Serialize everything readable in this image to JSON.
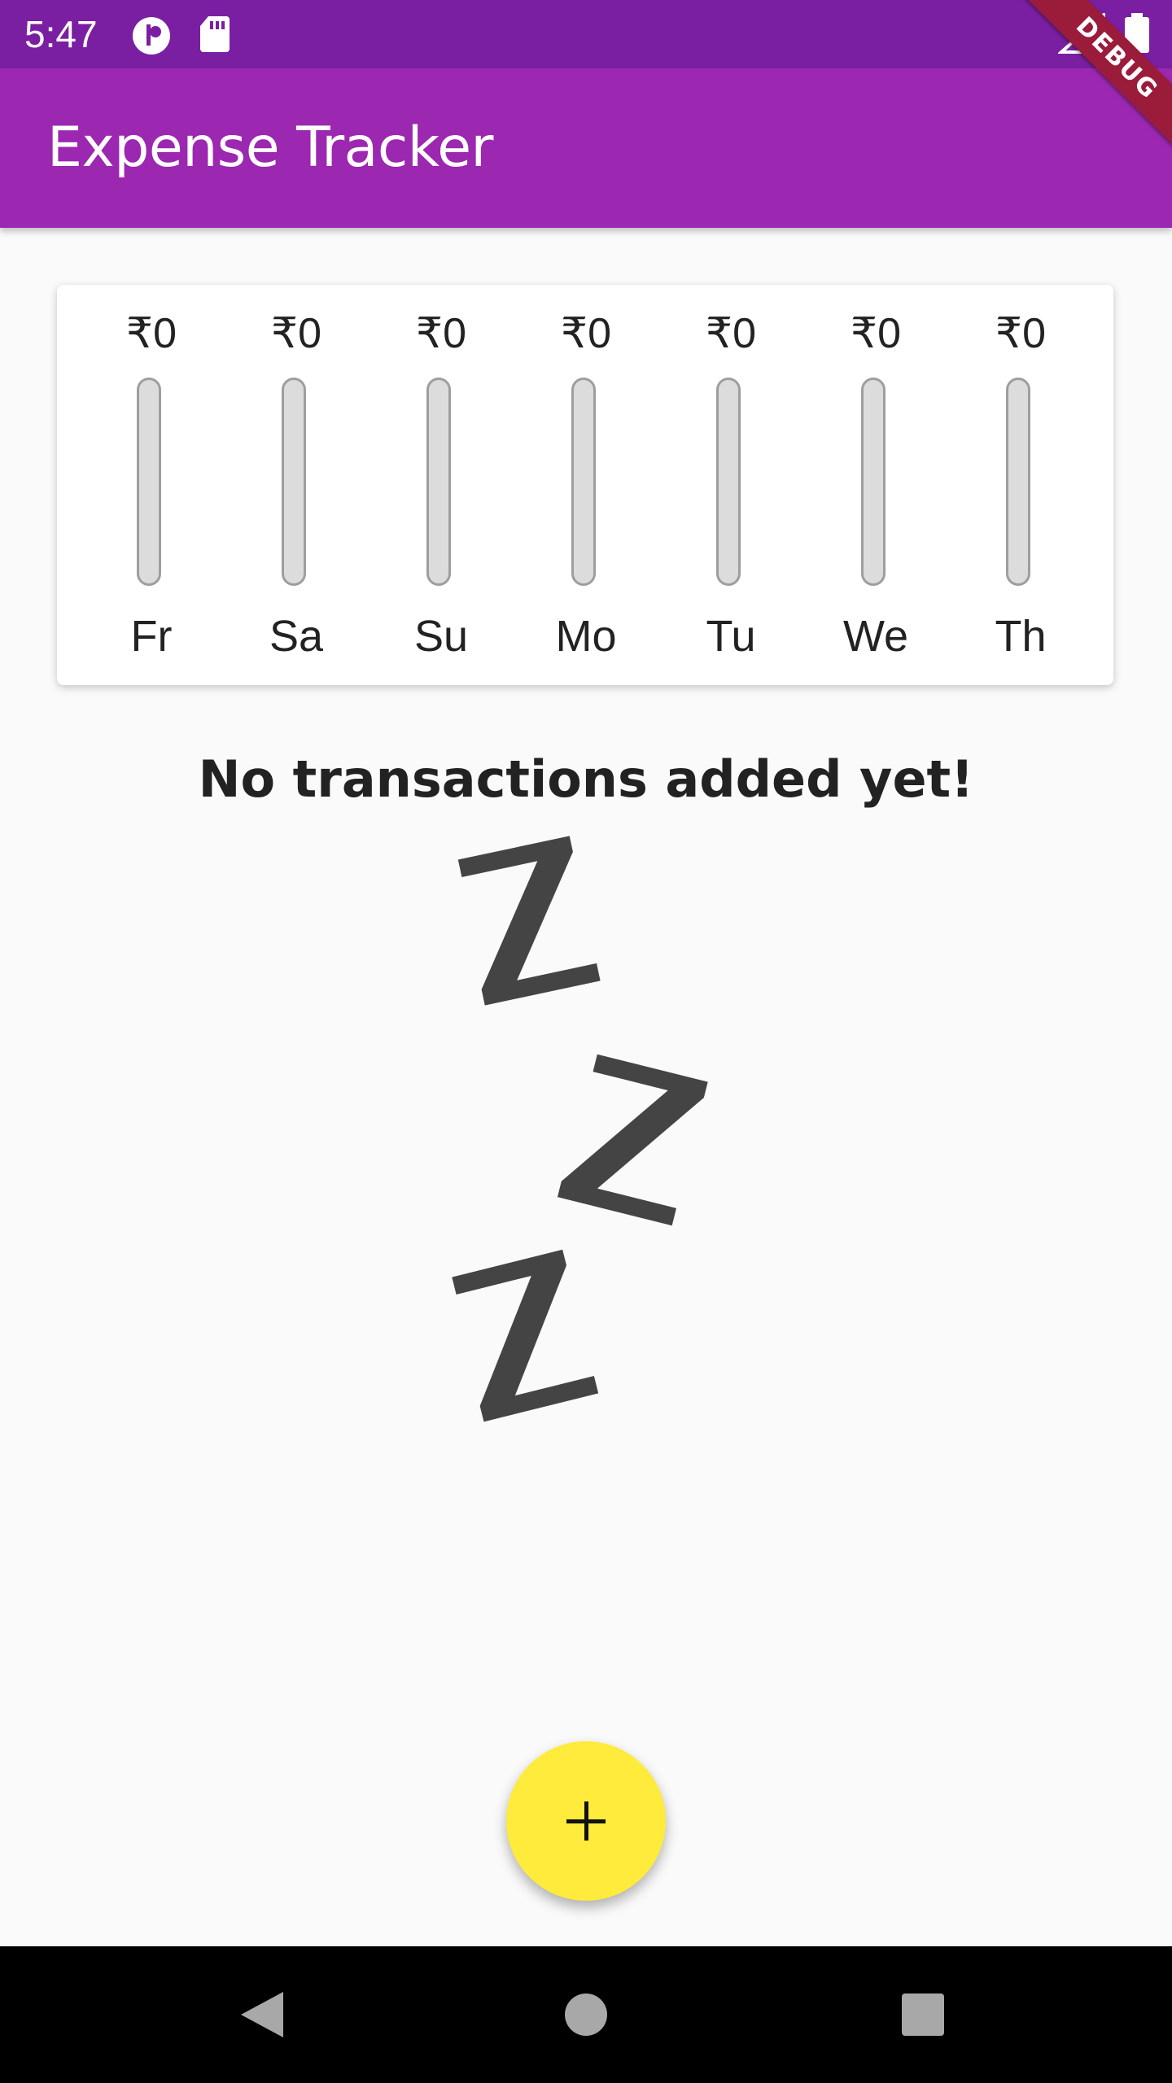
{
  "status_bar": {
    "time": "5:47",
    "left_icons": [
      "circle-badge-icon",
      "sd-card-icon"
    ],
    "right_icons": [
      "cell-signal-icon",
      "battery-icon"
    ]
  },
  "app_bar": {
    "title": "Expense Tracker"
  },
  "debug_banner": {
    "label": "DEBUG"
  },
  "chart": {
    "days": [
      {
        "label": "Fr",
        "amount": "₹0",
        "fill_pct": 0
      },
      {
        "label": "Sa",
        "amount": "₹0",
        "fill_pct": 0
      },
      {
        "label": "Su",
        "amount": "₹0",
        "fill_pct": 0
      },
      {
        "label": "Mo",
        "amount": "₹0",
        "fill_pct": 0
      },
      {
        "label": "Tu",
        "amount": "₹0",
        "fill_pct": 0
      },
      {
        "label": "We",
        "amount": "₹0",
        "fill_pct": 0
      },
      {
        "label": "Th",
        "amount": "₹0",
        "fill_pct": 0
      }
    ],
    "bar_fill_color": "#9c27b0",
    "bar_track_color": "#dcdcdc"
  },
  "empty_state": {
    "message": "No transactions added yet!",
    "image_icon": "sleep-zzz-icon"
  },
  "fab": {
    "icon": "plus-icon",
    "color": "#ffeb3b"
  },
  "nav_bar": {
    "icons": [
      "back-icon",
      "home-icon",
      "recents-icon"
    ]
  },
  "colors": {
    "primary": "#9c27b0",
    "primary_dark": "#7b1fa2",
    "accent": "#ffeb3b"
  }
}
